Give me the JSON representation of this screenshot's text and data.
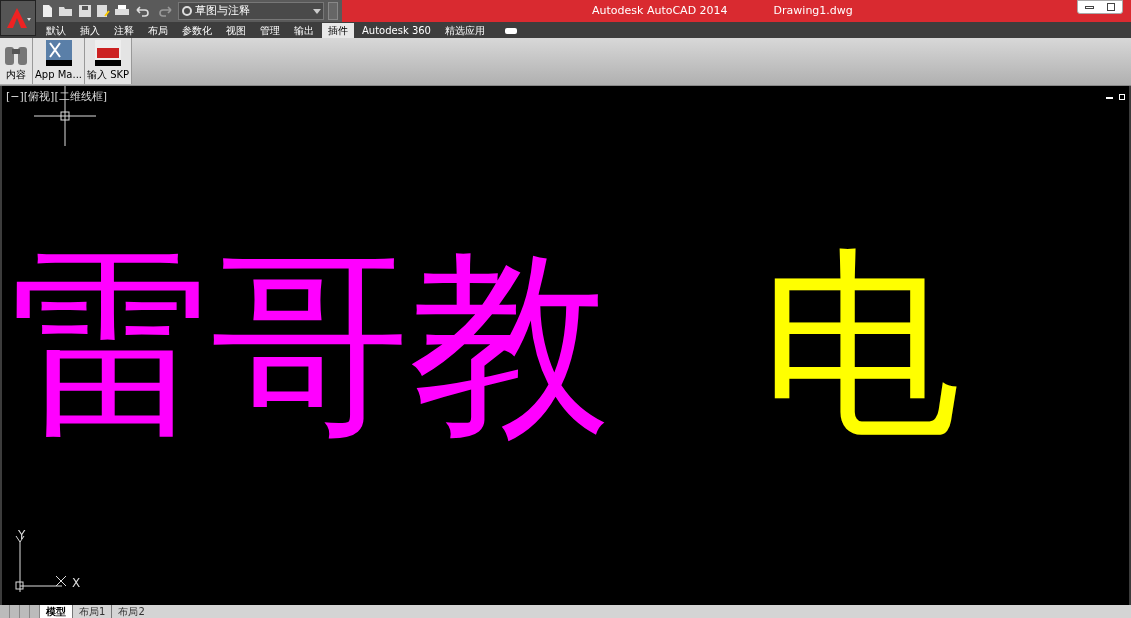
{
  "window": {
    "app_title": "Autodesk AutoCAD 2014",
    "document_title": "Drawing1.dwg"
  },
  "quick_access": {
    "workspace": "草图与注释"
  },
  "ribbon_tabs": [
    {
      "label": "默认",
      "selected": false
    },
    {
      "label": "插入",
      "selected": false
    },
    {
      "label": "注释",
      "selected": false
    },
    {
      "label": "布局",
      "selected": false
    },
    {
      "label": "参数化",
      "selected": false
    },
    {
      "label": "视图",
      "selected": false
    },
    {
      "label": "管理",
      "selected": false
    },
    {
      "label": "输出",
      "selected": false
    },
    {
      "label": "插件",
      "selected": true
    },
    {
      "label": "Autodesk 360",
      "selected": false
    },
    {
      "label": "精选应用",
      "selected": false
    }
  ],
  "ribbon_buttons": [
    {
      "kind": "binoculars",
      "label": "内容"
    },
    {
      "kind": "appmanager",
      "label": "App Ma..."
    },
    {
      "kind": "skp",
      "label": "输入 SKP"
    }
  ],
  "viewport": {
    "label": "[−][俯视][二维线框]",
    "texts": [
      {
        "text": "雷哥教",
        "color": "#ff00ff"
      },
      {
        "text": "电",
        "color": "#ffff00"
      }
    ],
    "axis_y": "Y",
    "axis_x": "X"
  },
  "layout_tabs": [
    {
      "label": "模型",
      "selected": true
    },
    {
      "label": "布局1",
      "selected": false
    },
    {
      "label": "布局2",
      "selected": false
    }
  ]
}
